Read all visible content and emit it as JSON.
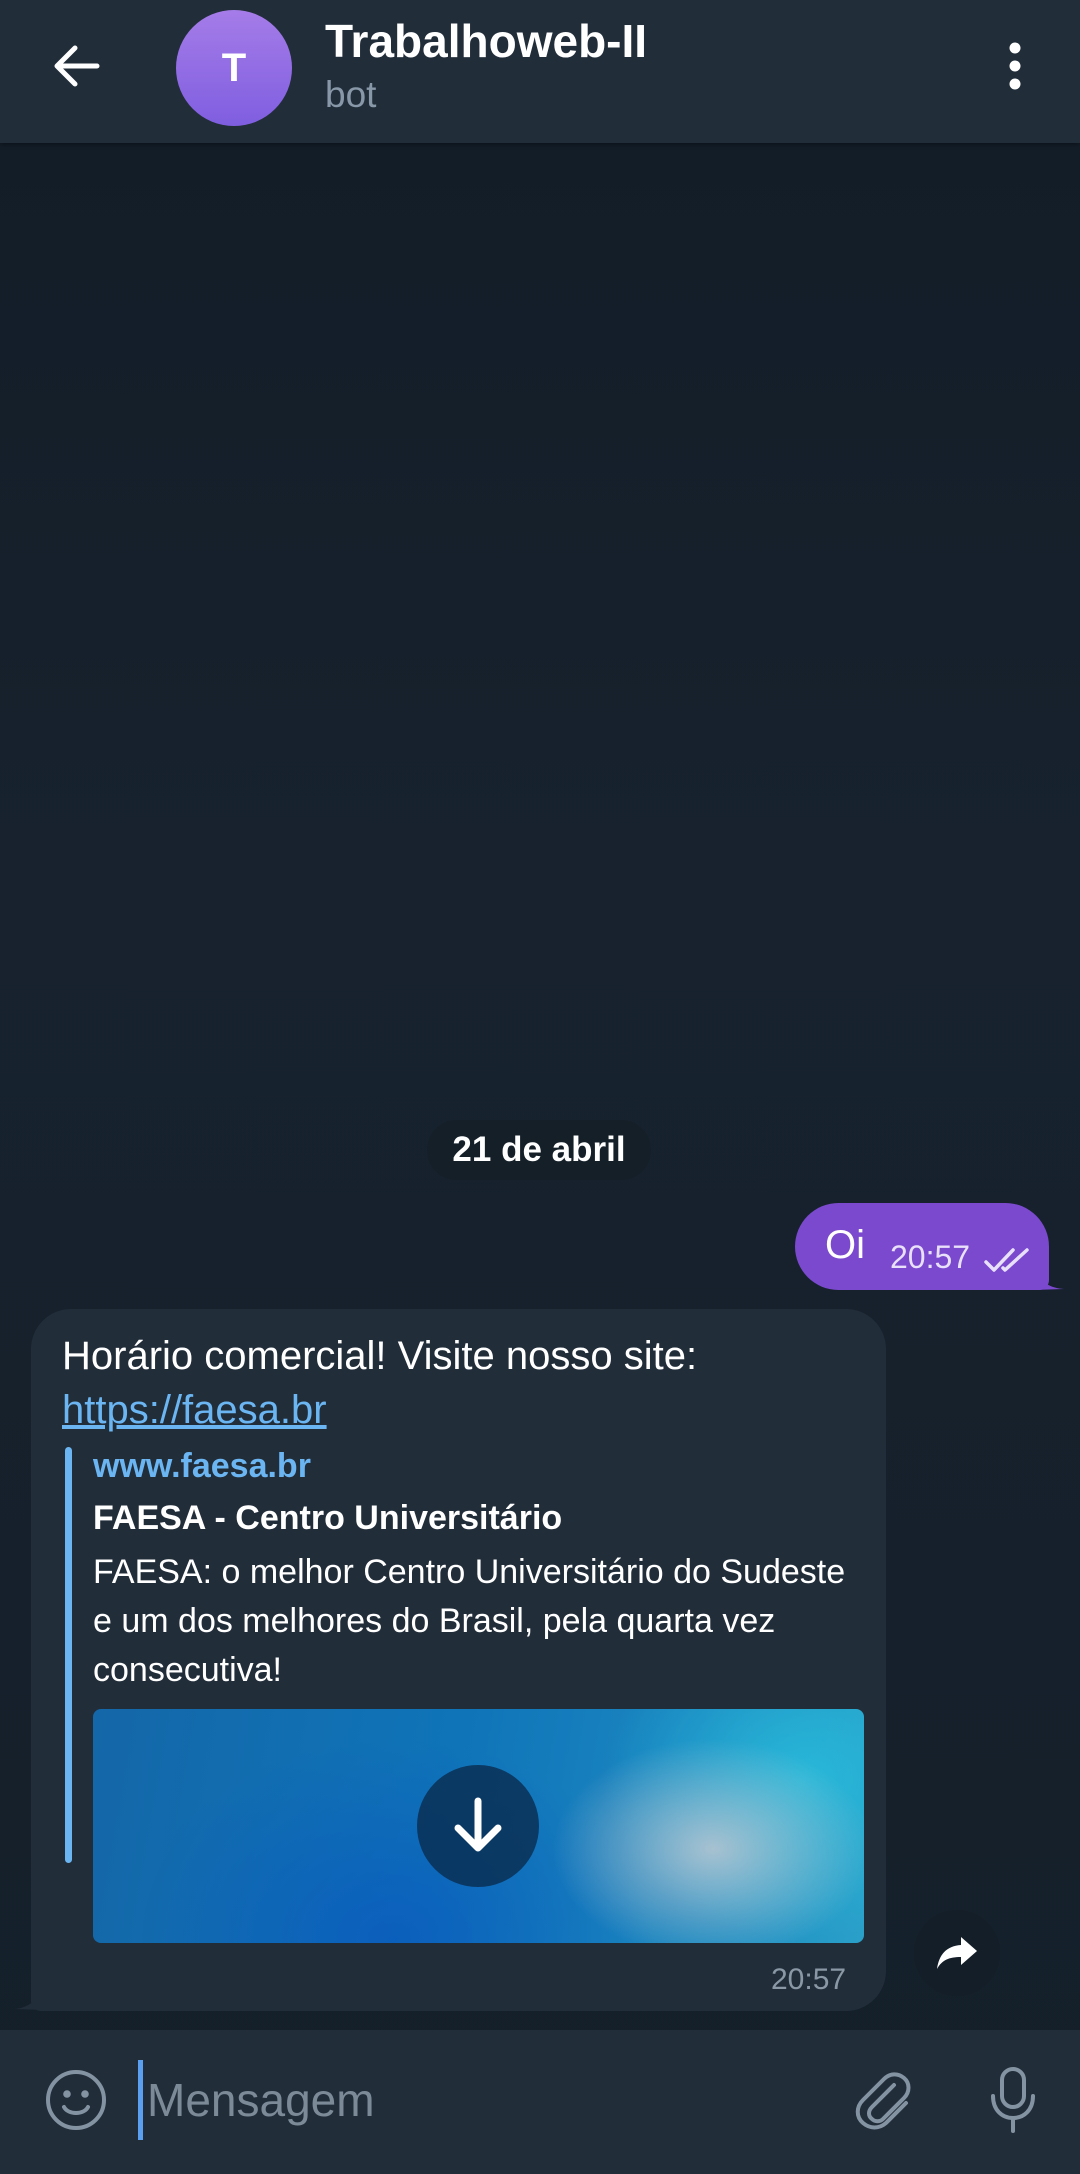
{
  "header": {
    "back_icon": "arrow-left-icon",
    "avatar_letter": "T",
    "title": "Trabalhoweb-II",
    "subtitle": "bot",
    "menu_icon": "more-vertical-icon"
  },
  "chat": {
    "date_separator": "21 de abril",
    "outgoing": {
      "text": "Oi",
      "time": "20:57",
      "status_icon": "double-check-icon"
    },
    "incoming": {
      "text": "Horário comercial! Visite nosso site:",
      "link": "https://faesa.br",
      "preview": {
        "site": "www.faesa.br",
        "title": "FAESA - Centro Universitário",
        "description": "FAESA: o melhor Centro Universitário do Sudeste e um dos melhores do Brasil, pela quarta vez consecutiva!",
        "download_icon": "download-arrow-icon"
      },
      "time": "20:57"
    },
    "forward_icon": "forward-share-icon"
  },
  "composer": {
    "emoji_icon": "emoji-smile-icon",
    "placeholder": "Mensagem",
    "attach_icon": "paperclip-icon",
    "mic_icon": "microphone-icon"
  },
  "colors": {
    "header_bg": "#222d3a",
    "background": "#141f2a",
    "outgoing_bubble": "#7a49cd",
    "incoming_bubble": "#222d3a",
    "link": "#6bb6f2",
    "avatar": "#8e69e4"
  }
}
